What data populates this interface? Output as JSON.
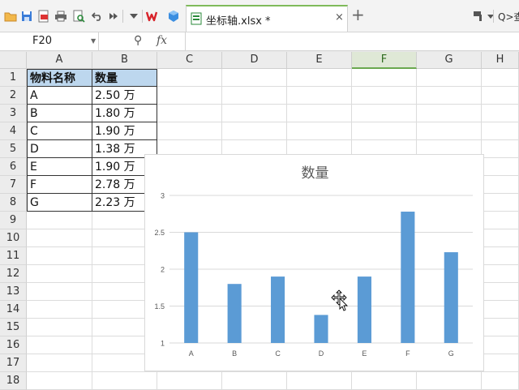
{
  "toolbar": {
    "doc_tab_label": "坐标轴.xlsx *",
    "close_glyph": "×",
    "add_glyph": "+",
    "search_label": "Q>查",
    "icons": [
      "open-folder-icon",
      "save-icon",
      "export-pdf-icon",
      "print-icon",
      "print-preview-icon",
      "undo-icon",
      "redo-icon",
      "dropdown-icon",
      "wps-logo-icon",
      "app-cube-icon",
      "spreadsheet-icon",
      "format-painter-icon"
    ]
  },
  "formula_bar": {
    "name_box": "F20",
    "zoom_glyph": "⚲",
    "fx_label": "fx",
    "value": ""
  },
  "grid": {
    "columns": [
      "A",
      "B",
      "C",
      "D",
      "E",
      "F",
      "G",
      "H"
    ],
    "active_column": "F",
    "rows": [
      "1",
      "2",
      "3",
      "4",
      "5",
      "6",
      "7",
      "8",
      "9",
      "10",
      "11",
      "12",
      "13",
      "14",
      "15",
      "16",
      "17",
      "18"
    ],
    "headers": [
      "物料名称",
      "数量"
    ],
    "data": [
      [
        "A",
        "2.50 万"
      ],
      [
        "B",
        "1.80 万"
      ],
      [
        "C",
        "1.90 万"
      ],
      [
        "D",
        "1.38 万"
      ],
      [
        "E",
        "1.90 万"
      ],
      [
        "F",
        "2.78 万"
      ],
      [
        "G",
        "2.23 万"
      ]
    ]
  },
  "chart_data": {
    "type": "bar",
    "title": "数量",
    "categories": [
      "A",
      "B",
      "C",
      "D",
      "E",
      "F",
      "G"
    ],
    "series": [
      {
        "values": [
          2.5,
          1.8,
          1.9,
          1.38,
          1.9,
          2.78,
          2.23
        ]
      }
    ],
    "ylim": [
      1,
      3
    ],
    "yticks": [
      "1",
      "1.5",
      "2",
      "2.5",
      "3"
    ],
    "xlabel": "",
    "ylabel": "",
    "grid": true,
    "bar_color": "#5b9bd5",
    "gridline_color": "#d9d9d9"
  },
  "colors": {
    "header_fill": "#bdd7ee",
    "active_column_accent": "#6aa84f"
  }
}
